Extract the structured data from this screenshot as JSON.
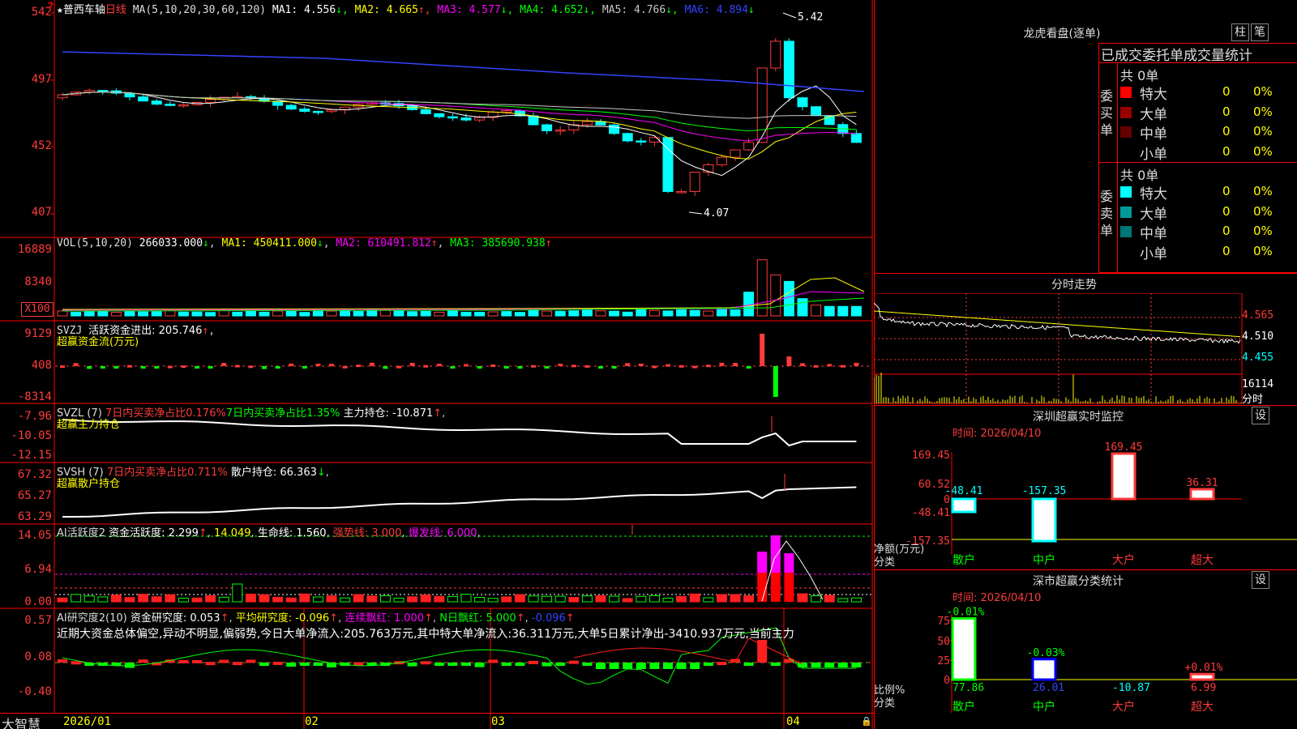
{
  "stock": {
    "name": "普西车轴",
    "star": "★",
    "period": "日线"
  },
  "main": {
    "ma_params": "MA(5,10,20,30,60,120)",
    "ma": [
      {
        "label": "MA1:",
        "value": "4.556",
        "arrow": "↓",
        "color": "#ffffff"
      },
      {
        "label": "MA2:",
        "value": "4.665",
        "arrow": "↑",
        "color": "#ffff00"
      },
      {
        "label": "MA3:",
        "value": "4.577",
        "arrow": "↓",
        "color": "#ff00ff"
      },
      {
        "label": "MA4:",
        "value": "4.652",
        "arrow": "↓",
        "color": "#00ff00"
      },
      {
        "label": "MA5:",
        "value": "4.766",
        "arrow": "↓",
        "color": "#c8c8c8"
      },
      {
        "label": "MA6:",
        "value": "4.894",
        "arrow": "↓",
        "color": "#3344ff"
      }
    ],
    "y_labels": [
      "542",
      "497",
      "452",
      "407"
    ],
    "high_mark": "5.42",
    "low_mark": "4.07",
    "question": "?"
  },
  "vol": {
    "label": "VOL(5,10,20)",
    "value": "266033.000",
    "arrow": "↓",
    "ma1": "MA1: 450411.000",
    "ma1_arrow": "↓",
    "ma2": "MA2: 610491.812",
    "ma2_arrow": "↑",
    "ma3": "MA3: 385690.938",
    "ma3_arrow": "↑",
    "y_labels": [
      "16889",
      "8340"
    ],
    "unit": "X100"
  },
  "svzj": {
    "label": "SVZJ",
    "text": "活跃资金进出: 205.746",
    "arrow": "↑",
    "comma": ",",
    "line2": "超赢资金流(万元)",
    "y_labels": [
      "9129",
      "408",
      "-8314"
    ]
  },
  "svzl": {
    "label": "SVZL (7)",
    "t1": "7日内买卖净占比0.176%",
    "t2": "7日内买卖净占比1.35%",
    "t3": "主力持仓: -10.871",
    "arrow": "↑",
    "comma": ",",
    "line2": "超赢主力持仓",
    "y_labels": [
      "-7.96",
      "-10.05",
      "-12.15"
    ]
  },
  "svsh": {
    "label": "SVSH (7)",
    "t1": "7日内买卖净占比0.711%",
    "t2": "散户持仓: 66.363",
    "arrow": "↓",
    "comma": ",",
    "line2": "超赢散户持仓",
    "y_labels": [
      "67.32",
      "65.27",
      "63.29"
    ]
  },
  "ai1": {
    "label": "AI活跃度2",
    "t1": "资金活跃度: 2.299",
    "a1": "↑",
    "t2": "14.049",
    "t3": "生命线: 1.560",
    "t4": "强势线: 3.000",
    "t5": "爆发线: 6.000",
    "y_labels": [
      "14.05",
      "6.94",
      "0.00"
    ]
  },
  "ai2": {
    "label": "AI研究度2(10)",
    "t1": "资金研究度: 0.053",
    "a1": "↑",
    "t2": "平均研究度: -0.096",
    "a2": "↑",
    "t3": "连续飘红: 1.000",
    "a3": "↑",
    "t4": "N日飘红: 5.000",
    "a4": "↑",
    "t5": "-0.096",
    "a5": "↑",
    "desc": "近期大资金总体偏空,异动不明显,偏弱势,今日大单净流入:205.763万元,其中特大单净流入:36.311万元,大单5日累计净出-3410.937万元,当前主力",
    "y_labels": [
      "0.57",
      "0.08",
      "-0.40"
    ]
  },
  "xaxis": {
    "brand": "大智慧",
    "ticks": [
      "2026/01",
      "02",
      "03",
      "04"
    ]
  },
  "dragon": {
    "title": "龙虎看盘(逐单)",
    "btn1": "柱",
    "btn2": "笔",
    "head": "已成交委托单成交量统计",
    "buy_side": "委买单",
    "sell_side": "委卖单",
    "buy_total": "共 0单",
    "sell_total": "共 0单",
    "rows_buy": [
      {
        "name": "特大",
        "v": "0",
        "p": "0%",
        "color": "#ff0000"
      },
      {
        "name": "大单",
        "v": "0",
        "p": "0%",
        "color": "#990000"
      },
      {
        "name": "中单",
        "v": "0",
        "p": "0%",
        "color": "#660000"
      },
      {
        "name": "小单",
        "v": "0",
        "p": "0%",
        "color": "#000000"
      }
    ],
    "rows_sell": [
      {
        "name": "特大",
        "v": "0",
        "p": "0%",
        "color": "#00ffff"
      },
      {
        "name": "大单",
        "v": "0",
        "p": "0%",
        "color": "#009999"
      },
      {
        "name": "中单",
        "v": "0",
        "p": "0%",
        "color": "#007777"
      },
      {
        "name": "小单",
        "v": "0",
        "p": "0%",
        "color": "#000000"
      }
    ]
  },
  "intraday": {
    "title": "分时走势",
    "y_labels": [
      "4.565",
      "4.510",
      "4.455"
    ],
    "vol_label": "16114",
    "vol_unit": "分时"
  },
  "monitor": {
    "title": "深圳超赢实时监控",
    "btn": "设",
    "time": "时间: 2026/04/10",
    "y_labels": [
      "169.45",
      "60.52",
      "0",
      "-48.41",
      "-157.35"
    ],
    "axis_label1": "净额(万元)",
    "axis_label2": "分类",
    "categories": [
      "散户",
      "中户",
      "大户",
      "超大"
    ],
    "values": [
      "-48.41",
      "-157.35",
      "169.45",
      "36.31"
    ]
  },
  "classify": {
    "title": "深市超赢分类统计",
    "btn": "设",
    "time": "时间: 2026/04/10",
    "y_labels": [
      "75",
      "50",
      "25",
      "0"
    ],
    "axis_label1": "比例%",
    "axis_label2": "分类",
    "categories": [
      "散户",
      "中户",
      "大户",
      "超大"
    ],
    "pct": [
      "77.86",
      "26.01",
      "-10.87",
      "6.99"
    ],
    "changes": [
      "-0.01%",
      "-0.03%",
      "",
      "+0.01%"
    ]
  }
}
